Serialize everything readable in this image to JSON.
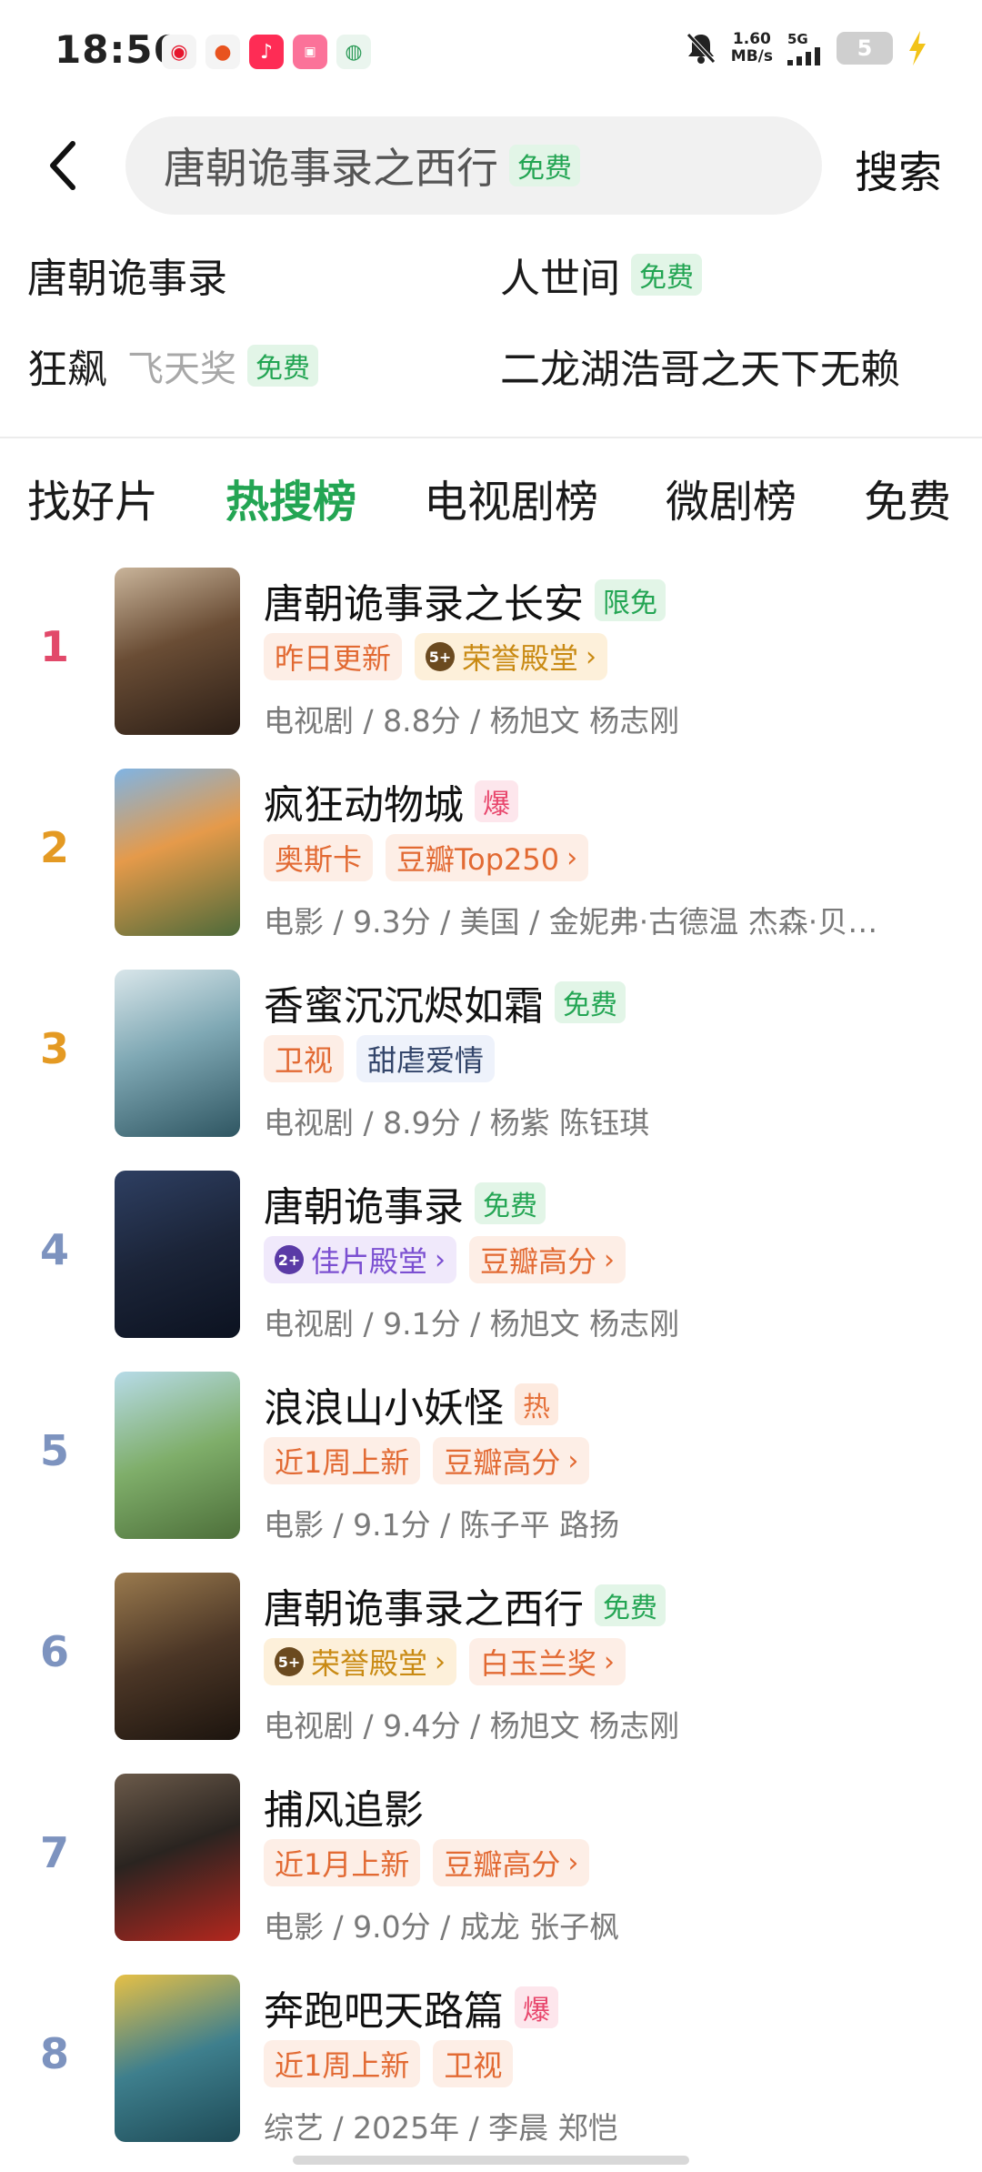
{
  "status_bar": {
    "time": "18:56",
    "net_speed_value": "1.60",
    "net_speed_unit": "MB/s",
    "network": "5G",
    "battery": "5",
    "app_icons": [
      "weibo-icon",
      "game-icon",
      "douyin-icon",
      "bilibili-icon",
      "app-icon"
    ]
  },
  "search": {
    "back_icon": "back-arrow-icon",
    "query": "唐朝诡事录之西行",
    "query_tag": "免费",
    "button_label": "搜索"
  },
  "suggestions": [
    {
      "label": "唐朝诡事录",
      "sub": "",
      "tag": ""
    },
    {
      "label": "人世间",
      "sub": "",
      "tag": "免费"
    },
    {
      "label": "狂飙",
      "sub": "飞天奖",
      "tag": "免费"
    },
    {
      "label": "二龙湖浩哥之天下无赖",
      "sub": "",
      "tag": ""
    }
  ],
  "tabs": [
    {
      "label": "找好片",
      "active": false
    },
    {
      "label": "热搜榜",
      "active": true
    },
    {
      "label": "电视剧榜",
      "active": false
    },
    {
      "label": "微剧榜",
      "active": false
    },
    {
      "label": "免费",
      "active": false
    }
  ],
  "colors": {
    "accent_green": "#23a553",
    "rank_1": "#e2496a",
    "rank_2_3": "#e49a23",
    "rank_rest": "#7d93bf"
  },
  "list": [
    {
      "rank": "1",
      "title": "唐朝诡事录之长安",
      "tag": "限免",
      "tag_style": "limited",
      "badges": [
        {
          "label": "昨日更新",
          "style": "orange",
          "chevron": false,
          "medal": ""
        },
        {
          "label": "荣誉殿堂",
          "style": "gold",
          "chevron": true,
          "medal": "5+"
        }
      ],
      "meta": "电视剧 / 8.8分 / 杨旭文 杨志刚"
    },
    {
      "rank": "2",
      "title": "疯狂动物城",
      "tag": "爆",
      "tag_style": "boom",
      "badges": [
        {
          "label": "奥斯卡",
          "style": "orange",
          "chevron": false,
          "medal": ""
        },
        {
          "label": "豆瓣Top250",
          "style": "orange",
          "chevron": true,
          "medal": ""
        }
      ],
      "meta": "电影 / 9.3分 / 美国 / 金妮弗·古德温 杰森·贝…"
    },
    {
      "rank": "3",
      "title": "香蜜沉沉烬如霜",
      "tag": "免费",
      "tag_style": "free",
      "badges": [
        {
          "label": "卫视",
          "style": "orange",
          "chevron": false,
          "medal": ""
        },
        {
          "label": "甜虐爱情",
          "style": "blue",
          "chevron": false,
          "medal": ""
        }
      ],
      "meta": "电视剧 / 8.9分 / 杨紫 陈钰琪"
    },
    {
      "rank": "4",
      "title": "唐朝诡事录",
      "tag": "免费",
      "tag_style": "free",
      "badges": [
        {
          "label": "佳片殿堂",
          "style": "purple",
          "chevron": true,
          "medal": "2+"
        },
        {
          "label": "豆瓣高分",
          "style": "orange",
          "chevron": true,
          "medal": ""
        }
      ],
      "meta": "电视剧 / 9.1分 / 杨旭文 杨志刚"
    },
    {
      "rank": "5",
      "title": "浪浪山小妖怪",
      "tag": "热",
      "tag_style": "hot",
      "badges": [
        {
          "label": "近1周上新",
          "style": "orange",
          "chevron": false,
          "medal": ""
        },
        {
          "label": "豆瓣高分",
          "style": "orange",
          "chevron": true,
          "medal": ""
        }
      ],
      "meta": "电影 / 9.1分 / 陈子平 路扬"
    },
    {
      "rank": "6",
      "title": "唐朝诡事录之西行",
      "tag": "免费",
      "tag_style": "free",
      "badges": [
        {
          "label": "荣誉殿堂",
          "style": "gold",
          "chevron": true,
          "medal": "5+"
        },
        {
          "label": "白玉兰奖",
          "style": "orange",
          "chevron": true,
          "medal": ""
        }
      ],
      "meta": "电视剧 / 9.4分 / 杨旭文 杨志刚"
    },
    {
      "rank": "7",
      "title": "捕风追影",
      "tag": "",
      "tag_style": "",
      "badges": [
        {
          "label": "近1月上新",
          "style": "orange",
          "chevron": false,
          "medal": ""
        },
        {
          "label": "豆瓣高分",
          "style": "orange",
          "chevron": true,
          "medal": ""
        }
      ],
      "meta": "电影 / 9.0分 / 成龙 张子枫"
    },
    {
      "rank": "8",
      "title": "奔跑吧天路篇",
      "tag": "爆",
      "tag_style": "boom",
      "badges": [
        {
          "label": "近1周上新",
          "style": "orange",
          "chevron": false,
          "medal": ""
        },
        {
          "label": "卫视",
          "style": "orange",
          "chevron": false,
          "medal": ""
        }
      ],
      "meta": "综艺 / 2025年 / 李晨 郑恺"
    }
  ]
}
